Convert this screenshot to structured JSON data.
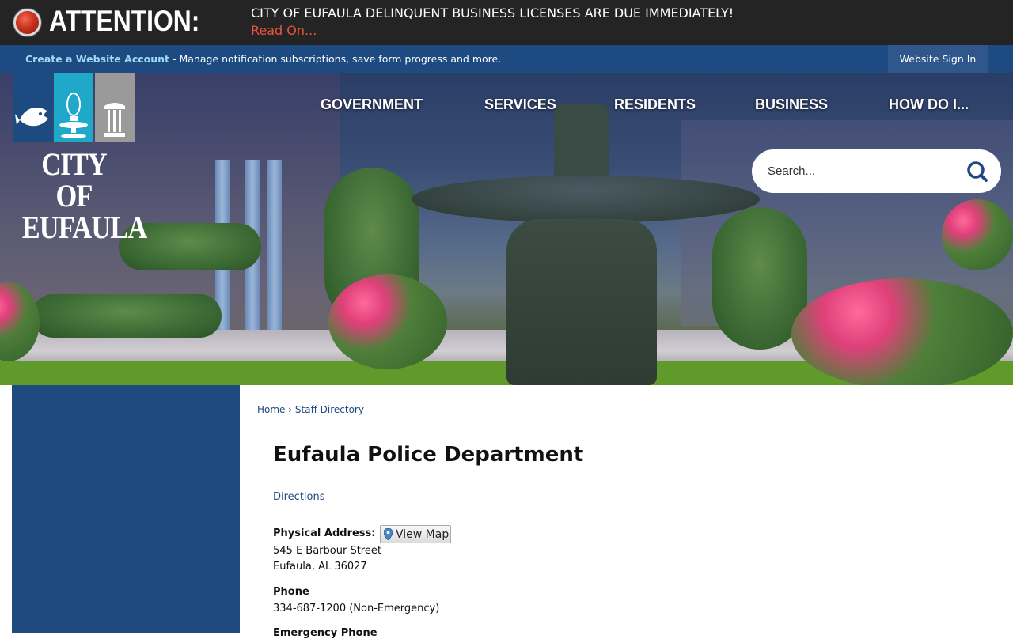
{
  "alert": {
    "title": "ATTENTION:",
    "message": "CITY OF EUFAULA DELINQUENT BUSINESS LICENSES ARE DUE IMMEDIATELY!",
    "link": "Read On..."
  },
  "account_bar": {
    "create_link": "Create a Website Account",
    "description": " - Manage notification subscriptions, save form progress and more.",
    "signin": "Website Sign In"
  },
  "logo": {
    "line1": "CITY OF",
    "line2": "EUFAULA",
    "tile_colors": [
      "#1d4a80",
      "#20a8c8",
      "#9a9a9a"
    ]
  },
  "nav": {
    "items": [
      {
        "label": "GOVERNMENT"
      },
      {
        "label": "SERVICES"
      },
      {
        "label": "RESIDENTS"
      },
      {
        "label": "BUSINESS"
      },
      {
        "label": "HOW DO I..."
      }
    ]
  },
  "search": {
    "placeholder": "Search...",
    "icon": "search-icon"
  },
  "breadcrumb": {
    "home": "Home",
    "separator": "›",
    "current": "Staff Directory"
  },
  "department": {
    "title": "Eufaula Police Department",
    "directions": "Directions",
    "physical_address_label": "Physical Address:",
    "view_map": "View Map",
    "address_line1": "545 E Barbour Street",
    "address_line2": "Eufaula, AL 36027",
    "phone_label": "Phone",
    "phone_value": "334-687-1200 (Non-Emergency)",
    "emergency_label": "Emergency Phone"
  },
  "colors": {
    "alert_bg": "#242424",
    "alert_link": "#e8553d",
    "brand_blue": "#1d4a80",
    "account_link": "#9fdcf4"
  }
}
